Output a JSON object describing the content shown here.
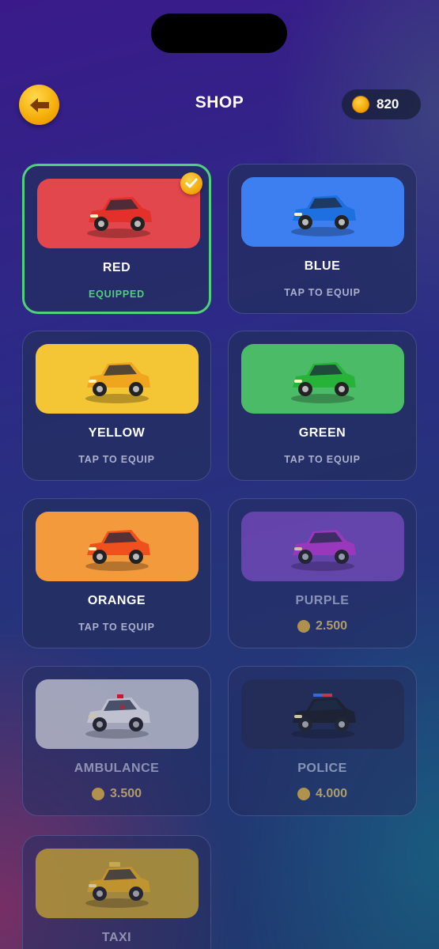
{
  "header": {
    "title": "SHOP",
    "coins": "820"
  },
  "cars": [
    {
      "name": "RED",
      "status": "EQUIPPED",
      "state": "equipped",
      "color": "#e2474d",
      "body": "#e4302a"
    },
    {
      "name": "BLUE",
      "status": "TAP TO EQUIP",
      "state": "owned",
      "color": "#3d7ff0",
      "body": "#1e6fe0"
    },
    {
      "name": "YELLOW",
      "status": "TAP TO EQUIP",
      "state": "owned",
      "color": "#f4c534",
      "body": "#f0a51e"
    },
    {
      "name": "GREEN",
      "status": "TAP TO EQUIP",
      "state": "owned",
      "color": "#4cbb68",
      "body": "#27b33a"
    },
    {
      "name": "ORANGE",
      "status": "TAP TO EQUIP",
      "state": "owned",
      "color": "#f39a3c",
      "body": "#f0501e"
    },
    {
      "name": "PURPLE",
      "price": "2.500",
      "state": "locked",
      "color": "#7a4cc0",
      "body": "#c23bd8"
    },
    {
      "name": "AMBULANCE",
      "price": "3.500",
      "state": "locked",
      "color": "#c9cbd6",
      "body": "#f2f2f2"
    },
    {
      "name": "POLICE",
      "price": "4.000",
      "state": "locked",
      "color": "#242c52",
      "body": "#1c1c24"
    },
    {
      "name": "TAXI",
      "state": "locked",
      "color": "#c7a532",
      "body": "#f0b51e"
    }
  ],
  "icons": {
    "back": "arrow-left-icon",
    "coin": "coin-icon",
    "check": "check-icon",
    "car": "car-icon"
  }
}
